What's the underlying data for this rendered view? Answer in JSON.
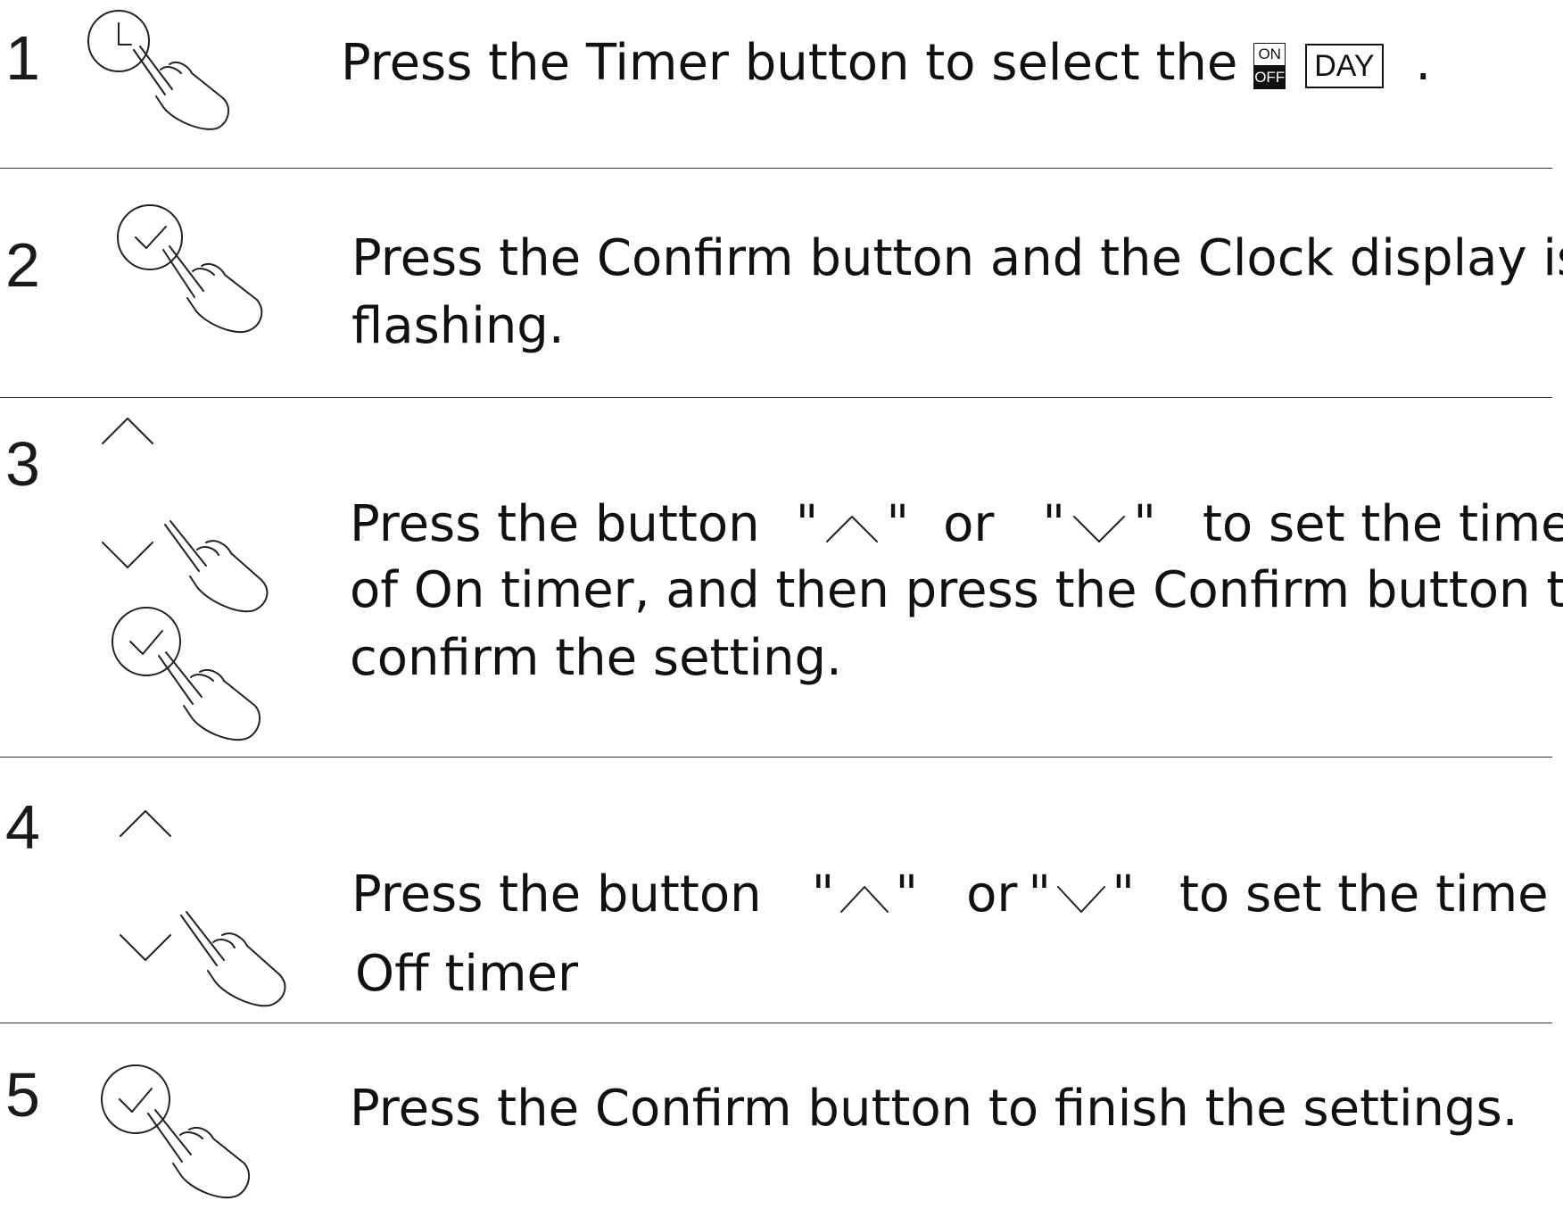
{
  "steps": [
    {
      "number": "1",
      "text_before": "Press the Timer button to select the",
      "on_label": "ON",
      "off_label": "OFF",
      "day_label": "DAY",
      "text_after": "."
    },
    {
      "number": "2",
      "line1": "Press the Confirm button and the Clock display is",
      "line2": "flashing."
    },
    {
      "number": "3",
      "l1_a": "Press the button",
      "l1_q": "\"",
      "l1_or": "or",
      "l1_b": "to set the time",
      "line2": "of On timer, and then press the Confirm button to",
      "line3": "confirm the setting."
    },
    {
      "number": "4",
      "l1_a": "Press the button",
      "l1_q": "\"",
      "l1_or": "or",
      "l1_b": "to set the time of",
      "line2": "Off timer"
    },
    {
      "number": "5",
      "line1": "Press the Confirm button to finish the settings."
    }
  ]
}
